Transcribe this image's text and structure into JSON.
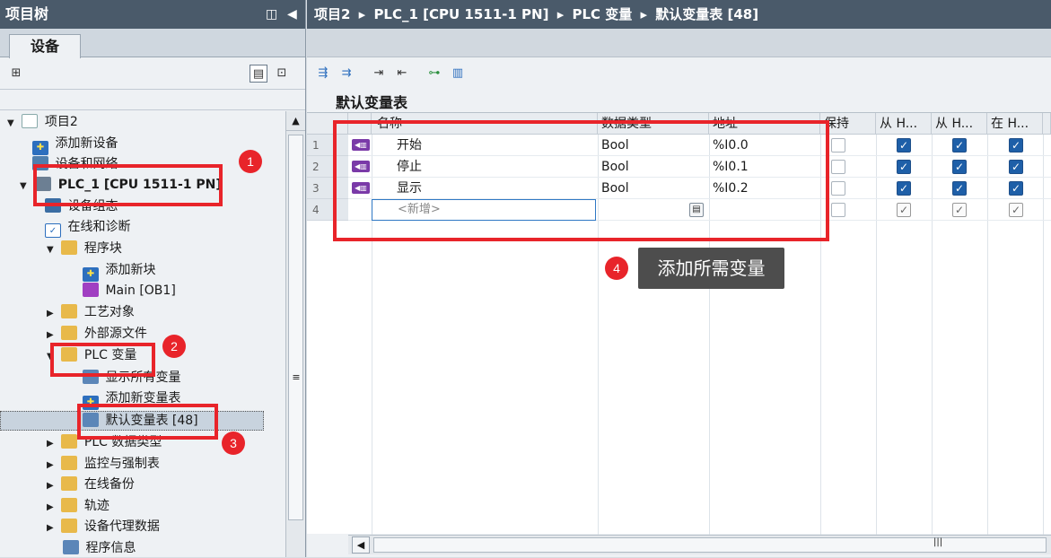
{
  "left_panel": {
    "title": "项目树",
    "tab": "设备",
    "tree": [
      {
        "label": "项目2",
        "expand": "▼",
        "icon": "project-icon"
      },
      {
        "label": "添加新设备",
        "expand": "",
        "icon": "add-device-icon"
      },
      {
        "label": "设备和网络",
        "expand": "",
        "icon": "network-icon"
      },
      {
        "label": "PLC_1 [CPU 1511-1 PN]",
        "expand": "▼",
        "icon": "plc-icon"
      },
      {
        "label": "设备组态",
        "expand": "",
        "icon": "device-config-icon"
      },
      {
        "label": "在线和诊断",
        "expand": "",
        "icon": "diagnostics-icon"
      },
      {
        "label": "程序块",
        "expand": "▼",
        "icon": "folder-icon"
      },
      {
        "label": "添加新块",
        "expand": "",
        "icon": "add-block-icon"
      },
      {
        "label": "Main [OB1]",
        "expand": "",
        "icon": "ob-icon"
      },
      {
        "label": "工艺对象",
        "expand": "▶",
        "icon": "folder-icon"
      },
      {
        "label": "外部源文件",
        "expand": "▶",
        "icon": "folder-icon"
      },
      {
        "label": "PLC 变量",
        "expand": "▼",
        "icon": "folder-icon"
      },
      {
        "label": "显示所有变量",
        "expand": "",
        "icon": "show-tags-icon"
      },
      {
        "label": "添加新变量表",
        "expand": "",
        "icon": "add-tagtable-icon"
      },
      {
        "label": "默认变量表 [48]",
        "expand": "",
        "icon": "tagtable-icon"
      },
      {
        "label": "PLC 数据类型",
        "expand": "▶",
        "icon": "folder-icon"
      },
      {
        "label": "监控与强制表",
        "expand": "▶",
        "icon": "folder-icon"
      },
      {
        "label": "在线备份",
        "expand": "▶",
        "icon": "folder-icon"
      },
      {
        "label": "轨迹",
        "expand": "▶",
        "icon": "folder-icon"
      },
      {
        "label": "设备代理数据",
        "expand": "▶",
        "icon": "folder-icon"
      },
      {
        "label": "程序信息",
        "expand": "",
        "icon": "program-info-icon"
      }
    ]
  },
  "right_panel": {
    "breadcrumb": [
      "项目2",
      "PLC_1 [CPU 1511-1 PN]",
      "PLC 变量",
      "默认变量表 [48]"
    ],
    "table_title": "默认变量表",
    "columns": [
      "名称",
      "数据类型",
      "地址",
      "保持",
      "从 H...",
      "从 H...",
      "在 H..."
    ],
    "rows": [
      {
        "num": "1",
        "name": "开始",
        "type": "Bool",
        "address": "%I0.0",
        "retain": false,
        "c1": true,
        "c2": true,
        "c3": true
      },
      {
        "num": "2",
        "name": "停止",
        "type": "Bool",
        "address": "%I0.1",
        "retain": false,
        "c1": true,
        "c2": true,
        "c3": true
      },
      {
        "num": "3",
        "name": "显示",
        "type": "Bool",
        "address": "%I0.2",
        "retain": false,
        "c1": true,
        "c2": true,
        "c3": true
      }
    ],
    "new_row": {
      "num": "4",
      "placeholder": "<新增>"
    }
  },
  "annotations": {
    "badges": [
      "1",
      "2",
      "3",
      "4"
    ],
    "callout": "添加所需变量"
  },
  "colors": {
    "title_bar": "#4a5a6a",
    "annotation_red": "#e8242a",
    "checkbox_blue": "#1e5fa8",
    "tag_icon": "#7a3aa8"
  }
}
